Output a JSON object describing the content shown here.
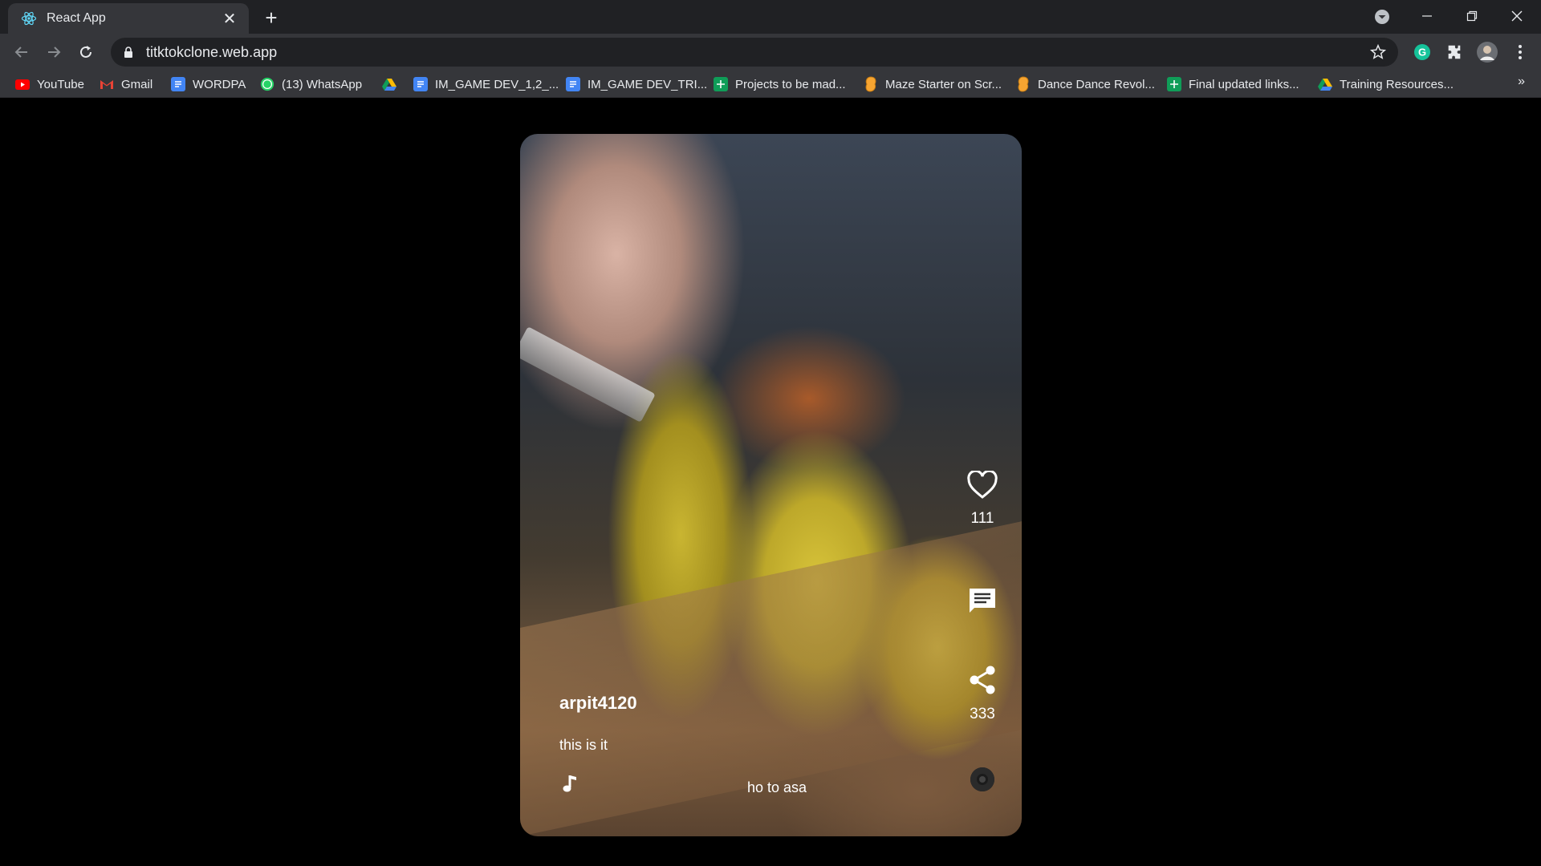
{
  "browser": {
    "tab_title": "React App",
    "url": "titktokclone.web.app",
    "bookmarks": [
      {
        "label": "YouTube",
        "icon": "youtube-icon",
        "color": "#ff0000"
      },
      {
        "label": "Gmail",
        "icon": "gmail-icon",
        "color": "#ea4335"
      },
      {
        "label": "WORDPA",
        "icon": "docs-icon",
        "color": "#4285f4"
      },
      {
        "label": "(13) WhatsApp",
        "icon": "whatsapp-icon",
        "color": "#25d366"
      },
      {
        "label": "",
        "icon": "drive-icon",
        "color": "#fbbc04"
      },
      {
        "label": "IM_GAME DEV_1,2_...",
        "icon": "docs-icon",
        "color": "#4285f4"
      },
      {
        "label": "IM_GAME DEV_TRI...",
        "icon": "docs-icon",
        "color": "#4285f4"
      },
      {
        "label": "Projects to be mad...",
        "icon": "sheets-icon",
        "color": "#0f9d58"
      },
      {
        "label": "Maze Starter on Scr...",
        "icon": "scratch-icon",
        "color": "#f7a531"
      },
      {
        "label": "Dance Dance Revol...",
        "icon": "scratch-icon",
        "color": "#f7a531"
      },
      {
        "label": "Final updated links...",
        "icon": "sheets-icon",
        "color": "#0f9d58"
      },
      {
        "label": "Training Resources...",
        "icon": "drive-icon",
        "color": "#fbbc04"
      }
    ],
    "more_label": "»"
  },
  "video": {
    "username": "arpit4120",
    "caption": "this is it",
    "song": "ho to asa",
    "likes": "111",
    "shares": "333"
  }
}
